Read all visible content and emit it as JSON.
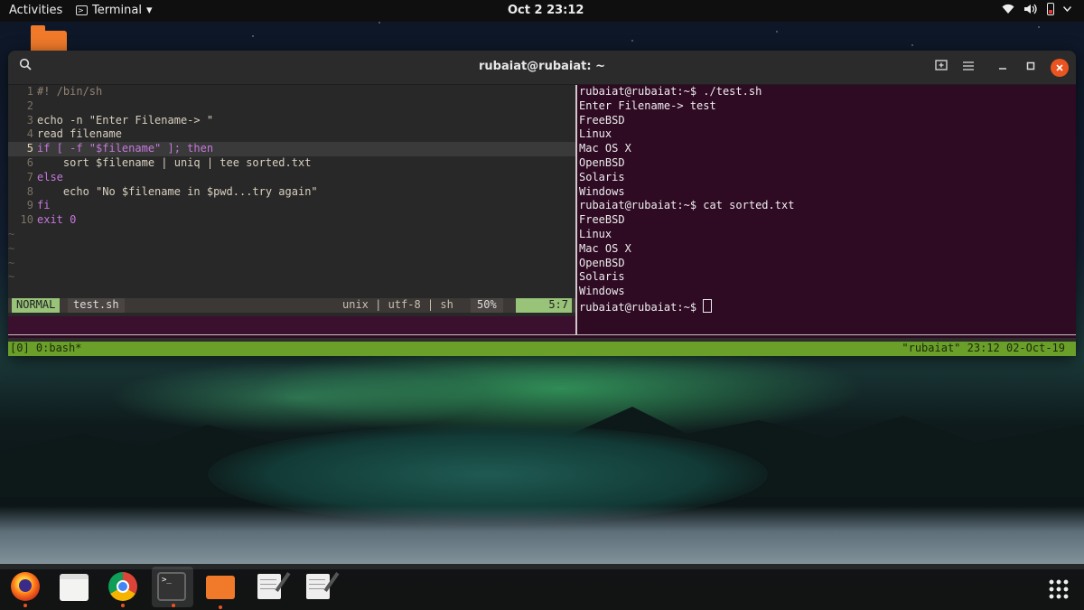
{
  "topbar": {
    "activities": "Activities",
    "app_name": "Terminal",
    "app_menu_arrow": "▾",
    "clock": "Oct 2  23:12",
    "icons": [
      "wifi-icon",
      "volume-icon",
      "battery-icon",
      "chevron-down-icon"
    ]
  },
  "window": {
    "title": "rubaiat@rubaiat: ~",
    "buttons": [
      "search-button",
      "new-tab-button",
      "menu-button",
      "minimize-button",
      "maximize-button",
      "close-button"
    ]
  },
  "vim": {
    "lines": [
      {
        "n": "1",
        "code": "#! /bin/sh"
      },
      {
        "n": "2",
        "code": ""
      },
      {
        "n": "3",
        "code": "echo -n \"Enter Filename-> \""
      },
      {
        "n": "4",
        "code": "read filename"
      },
      {
        "n": "5",
        "code": "if [ -f \"$filename\" ]; then"
      },
      {
        "n": "6",
        "code": "    sort $filename | uniq | tee sorted.txt"
      },
      {
        "n": "7",
        "code": "else"
      },
      {
        "n": "8",
        "code": "    echo \"No $filename in $pwd...try again\""
      },
      {
        "n": "9",
        "code": "fi"
      },
      {
        "n": "10",
        "code": "exit 0"
      }
    ],
    "tilde": "~",
    "status": {
      "mode": "NORMAL",
      "file": "test.sh",
      "encoding": "unix | utf-8 | sh",
      "percent": "50%",
      "position": "5:7"
    }
  },
  "shell": {
    "lines": [
      "rubaiat@rubaiat:~$ ./test.sh",
      "Enter Filename-> test",
      "FreeBSD",
      "Linux",
      "Mac OS X",
      "OpenBSD",
      "Solaris",
      "Windows",
      "rubaiat@rubaiat:~$ cat sorted.txt",
      "FreeBSD",
      "Linux",
      "Mac OS X",
      "OpenBSD",
      "Solaris",
      "Windows"
    ],
    "prompt": "rubaiat@rubaiat:~$ "
  },
  "tmux": {
    "left": "[0] 0:bash*",
    "right": "\"rubaiat\" 23:12 02-Oct-19"
  },
  "dock": {
    "apps": [
      "firefox-icon",
      "files-icon",
      "chrome-icon",
      "terminal-icon",
      "folder-icon",
      "text-editor-icon",
      "text-editor-icon"
    ],
    "terminal_glyph": ">_",
    "show_apps": "show-applications-icon"
  },
  "colors": {
    "accent": "#e95420",
    "tmux_bar": "#6a9f2a",
    "vim_mode": "#98c379",
    "shell_bg": "#2e0a23"
  }
}
